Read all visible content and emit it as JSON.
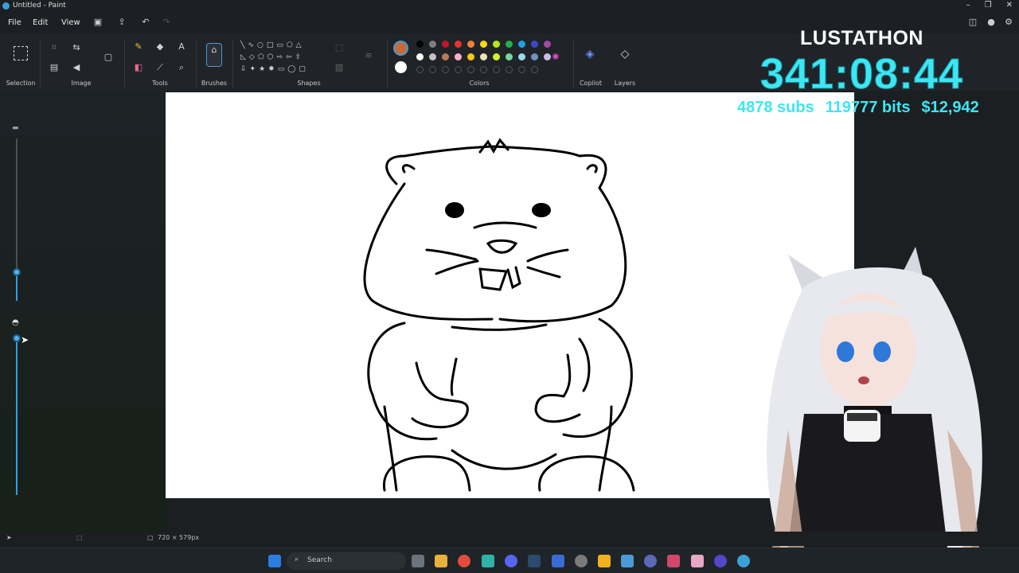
{
  "window": {
    "title": "Untitled - Paint",
    "minimize": "–",
    "maximize": "❐",
    "close": "✕"
  },
  "menu": {
    "file": "File",
    "edit": "Edit",
    "view": "View"
  },
  "ribbon": {
    "groups": {
      "selection": "Selection",
      "image": "Image",
      "tools": "Tools",
      "brushes": "Brushes",
      "shapes": "Shapes",
      "colors": "Colors",
      "copilot": "Copilot",
      "layers": "Layers"
    },
    "primary_color": "#c8693a",
    "secondary_color": "#ffffff",
    "palette_row1": [
      "#000000",
      "#7f7f7f",
      "#c0162c",
      "#e5352b",
      "#f0823b",
      "#f5d71d",
      "#b5e61d",
      "#22b14c",
      "#1fa3e0",
      "#3f48cc",
      "#a349a4"
    ],
    "palette_row2": [
      "#ffffff",
      "#c3c3c3",
      "#b97a57",
      "#ffaec9",
      "#ffc90e",
      "#efe4b0",
      "#d2f12a",
      "#74d9a0",
      "#99d9ea",
      "#7092be",
      "#c8bfe7"
    ]
  },
  "overlay": {
    "title": "LUSTATHON",
    "timer": "341:08:44",
    "subs": "4878 subs",
    "bits": "119777 bits",
    "money": "$12,942"
  },
  "status": {
    "canvas_size": "720 × 579px"
  },
  "taskbar": {
    "search_placeholder": "Search"
  }
}
